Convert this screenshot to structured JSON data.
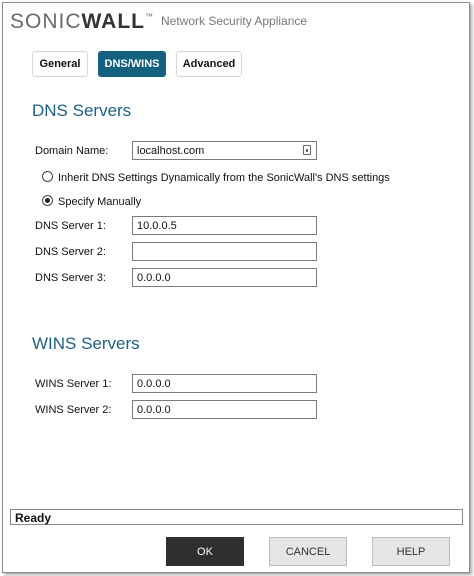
{
  "brand": {
    "logo_light_1": "SONIC",
    "logo_bold": "WALL",
    "logo_tm": "™",
    "subtitle": "Network Security Appliance"
  },
  "tabs": [
    {
      "label": "General",
      "active": false
    },
    {
      "label": "DNS/WINS",
      "active": true
    },
    {
      "label": "Advanced",
      "active": false
    }
  ],
  "dns": {
    "title": "DNS Servers",
    "domain_label": "Domain Name:",
    "domain_value": "localhost.com",
    "inherit_label": "Inherit DNS Settings Dynamically from the SonicWall's DNS settings",
    "inherit_checked": false,
    "specify_label": "Specify Manually",
    "specify_checked": true,
    "servers": [
      {
        "label": "DNS Server 1:",
        "value": "10.0.0.5"
      },
      {
        "label": "DNS Server 2:",
        "value": ""
      },
      {
        "label": "DNS Server 3:",
        "value": "0.0.0.0"
      }
    ]
  },
  "wins": {
    "title": "WINS Servers",
    "servers": [
      {
        "label": "WINS Server 1:",
        "value": "0.0.0.0"
      },
      {
        "label": "WINS Server 2:",
        "value": "0.0.0.0"
      }
    ]
  },
  "status": "Ready",
  "buttons": {
    "ok": "OK",
    "cancel": "CANCEL",
    "help": "HELP"
  },
  "colors": {
    "accent": "#14607f",
    "title": "#1d5f84",
    "primary_button": "#2f2f2f"
  }
}
